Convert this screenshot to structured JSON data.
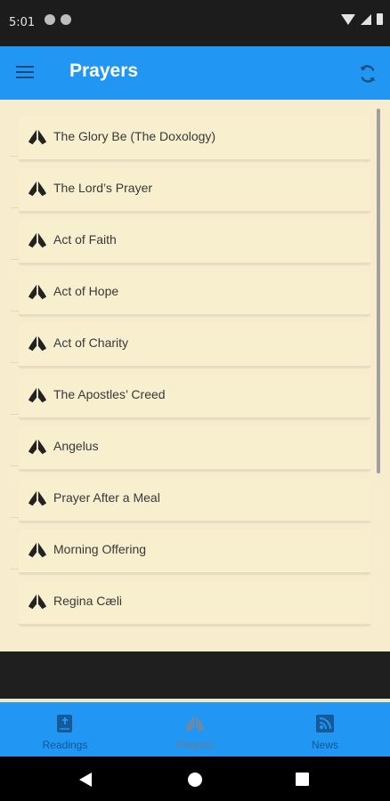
{
  "status_bar": {
    "time": "5:01",
    "left_icons": [
      "notification-icon",
      "notification-icon"
    ],
    "right_icons": [
      "wifi-icon",
      "signal-icon",
      "battery-icon"
    ]
  },
  "appbar": {
    "title": "Prayers",
    "menu_icon": "hamburger-menu-icon",
    "refresh_icon": "refresh-icon",
    "background_color": "#2196f3"
  },
  "prayers": [
    {
      "label": "The Glory Be (The Doxology)",
      "icon": "praying-hands-icon"
    },
    {
      "label": "The Lord’s Prayer",
      "icon": "praying-hands-icon"
    },
    {
      "label": "Act of Faith",
      "icon": "praying-hands-icon"
    },
    {
      "label": "Act of Hope",
      "icon": "praying-hands-icon"
    },
    {
      "label": "Act of Charity",
      "icon": "praying-hands-icon"
    },
    {
      "label": "The Apostles’ Creed",
      "icon": "praying-hands-icon"
    },
    {
      "label": "Angelus",
      "icon": "praying-hands-icon"
    },
    {
      "label": "Prayer After a Meal",
      "icon": "praying-hands-icon"
    },
    {
      "label": "Morning Offering",
      "icon": "praying-hands-icon"
    },
    {
      "label": "Regina Cæli",
      "icon": "praying-hands-icon"
    }
  ],
  "content_background": "#f7eccd",
  "bottom_nav": {
    "tabs": [
      {
        "label": "Readings",
        "icon": "bible-icon",
        "active": false
      },
      {
        "label": "Prayers",
        "icon": "praying-hands-icon",
        "active": true
      },
      {
        "label": "News",
        "icon": "rss-icon",
        "active": false
      }
    ],
    "background_color": "#2196f3"
  },
  "system_nav": {
    "buttons": [
      "back-icon",
      "home-icon",
      "recent-apps-icon"
    ]
  }
}
